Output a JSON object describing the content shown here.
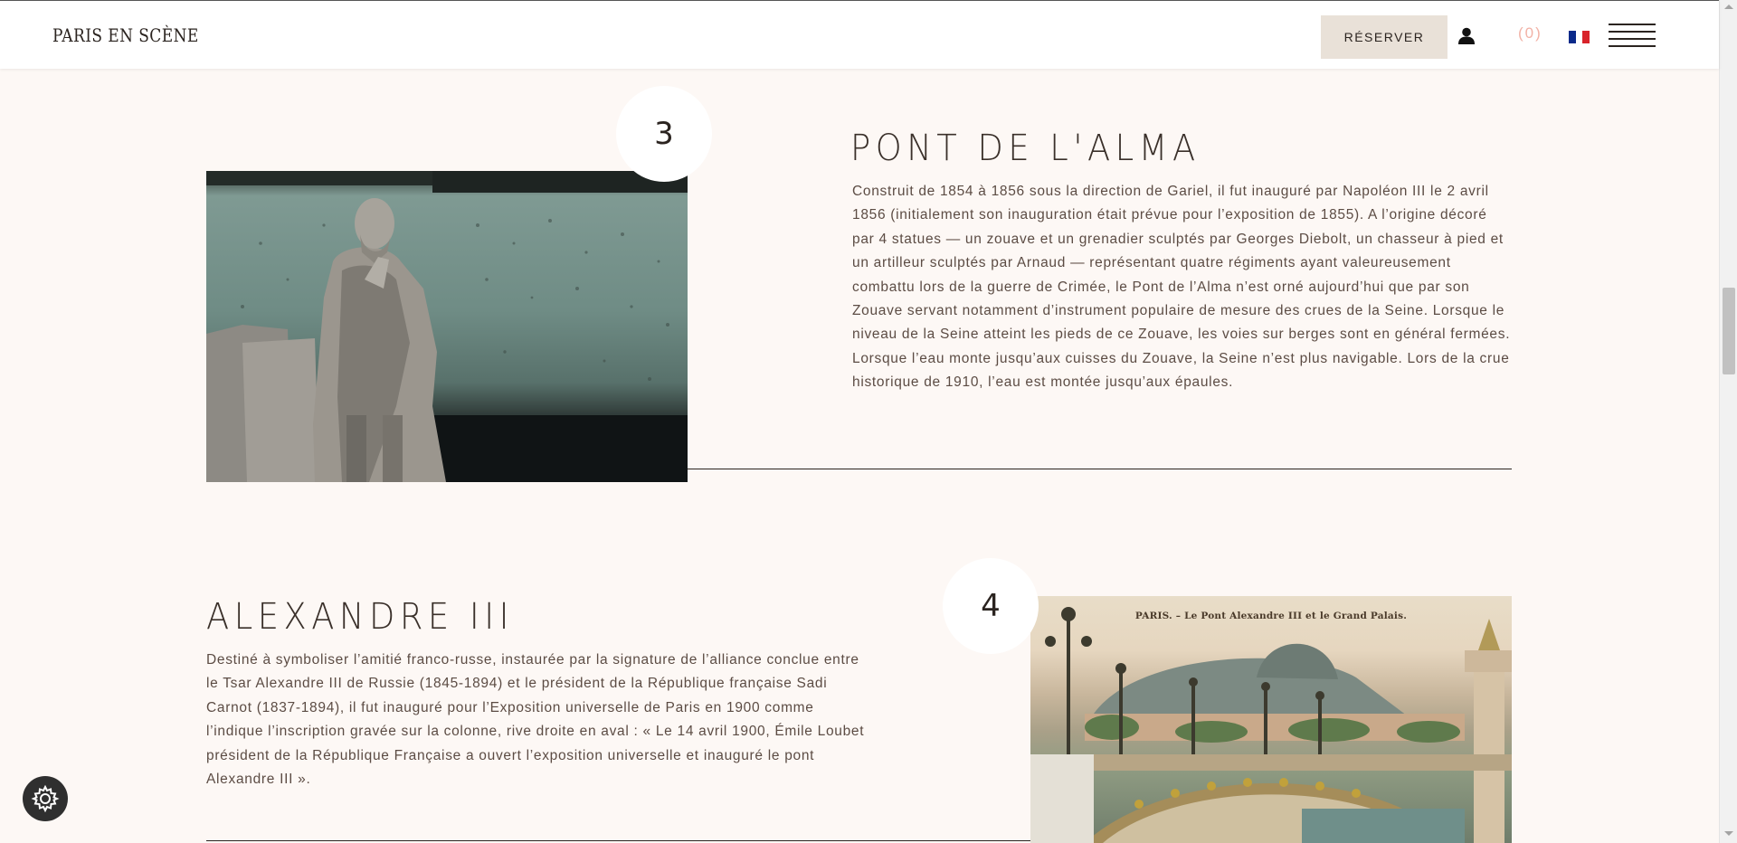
{
  "header": {
    "logo": "PARIS EN SCÈNE",
    "reserve_label": "RÉSERVER",
    "cart_count": "(0)",
    "icons": {
      "user": "user-icon",
      "flag": "flag-fr-icon",
      "menu": "hamburger-menu-icon"
    },
    "flag_colors": [
      "#0a2a8a",
      "#ffffff",
      "#d8232a"
    ]
  },
  "sections": [
    {
      "number": "3",
      "title": "PONT DE L'ALMA",
      "text": "Construit de 1854 à 1856 sous la direction de Gariel, il fut inauguré par Napoléon III le 2 avril 1856 (initialement son inauguration était prévue pour l’exposition de 1855). A l’origine décoré par 4 statues — un zouave et un grenadier sculptés par Georges Diebolt, un chasseur à pied et un artilleur sculptés par Arnaud — représentant quatre régiments ayant valeureusement combattu lors de la guerre de Crimée, le Pont de l’Alma n’est orné aujourd’hui que par son Zouave servant notamment d’instrument populaire de mesure des crues de la Seine. Lorsque le niveau de la Seine atteint les pieds de ce Zouave, les voies sur berges sont en général fermées. Lorsque l’eau monte jusqu’aux cuisses du Zouave, la Seine n’est plus navigable. Lors de la crue historique de 1910, l’eau est montée jusqu’aux épaules."
    },
    {
      "number": "4",
      "title": "ALEXANDRE III",
      "text": "Destiné à symboliser l’amitié franco-russe, instaurée par la signature de l’alliance conclue entre le Tsar Alexandre III de Russie (1845-1894) et le président de la République française Sadi Carnot (1837-1894), il fut inauguré pour l’Exposition universelle de Paris en 1900 comme l’indique l’inscription gravée sur la colonne, rive droite en aval : « Le 14 avril 1900, Émile Loubet président de la République Française a ouvert l’exposition universelle et inauguré le pont Alexandre III ».",
      "image_caption": "PARIS. – Le Pont Alexandre III et le Grand Palais."
    }
  ],
  "settings_icon": "gear-icon",
  "colors": {
    "background": "#fdf8f5",
    "accent_cart": "#f2b2a6",
    "reserve_bg": "#e9e1d8"
  }
}
